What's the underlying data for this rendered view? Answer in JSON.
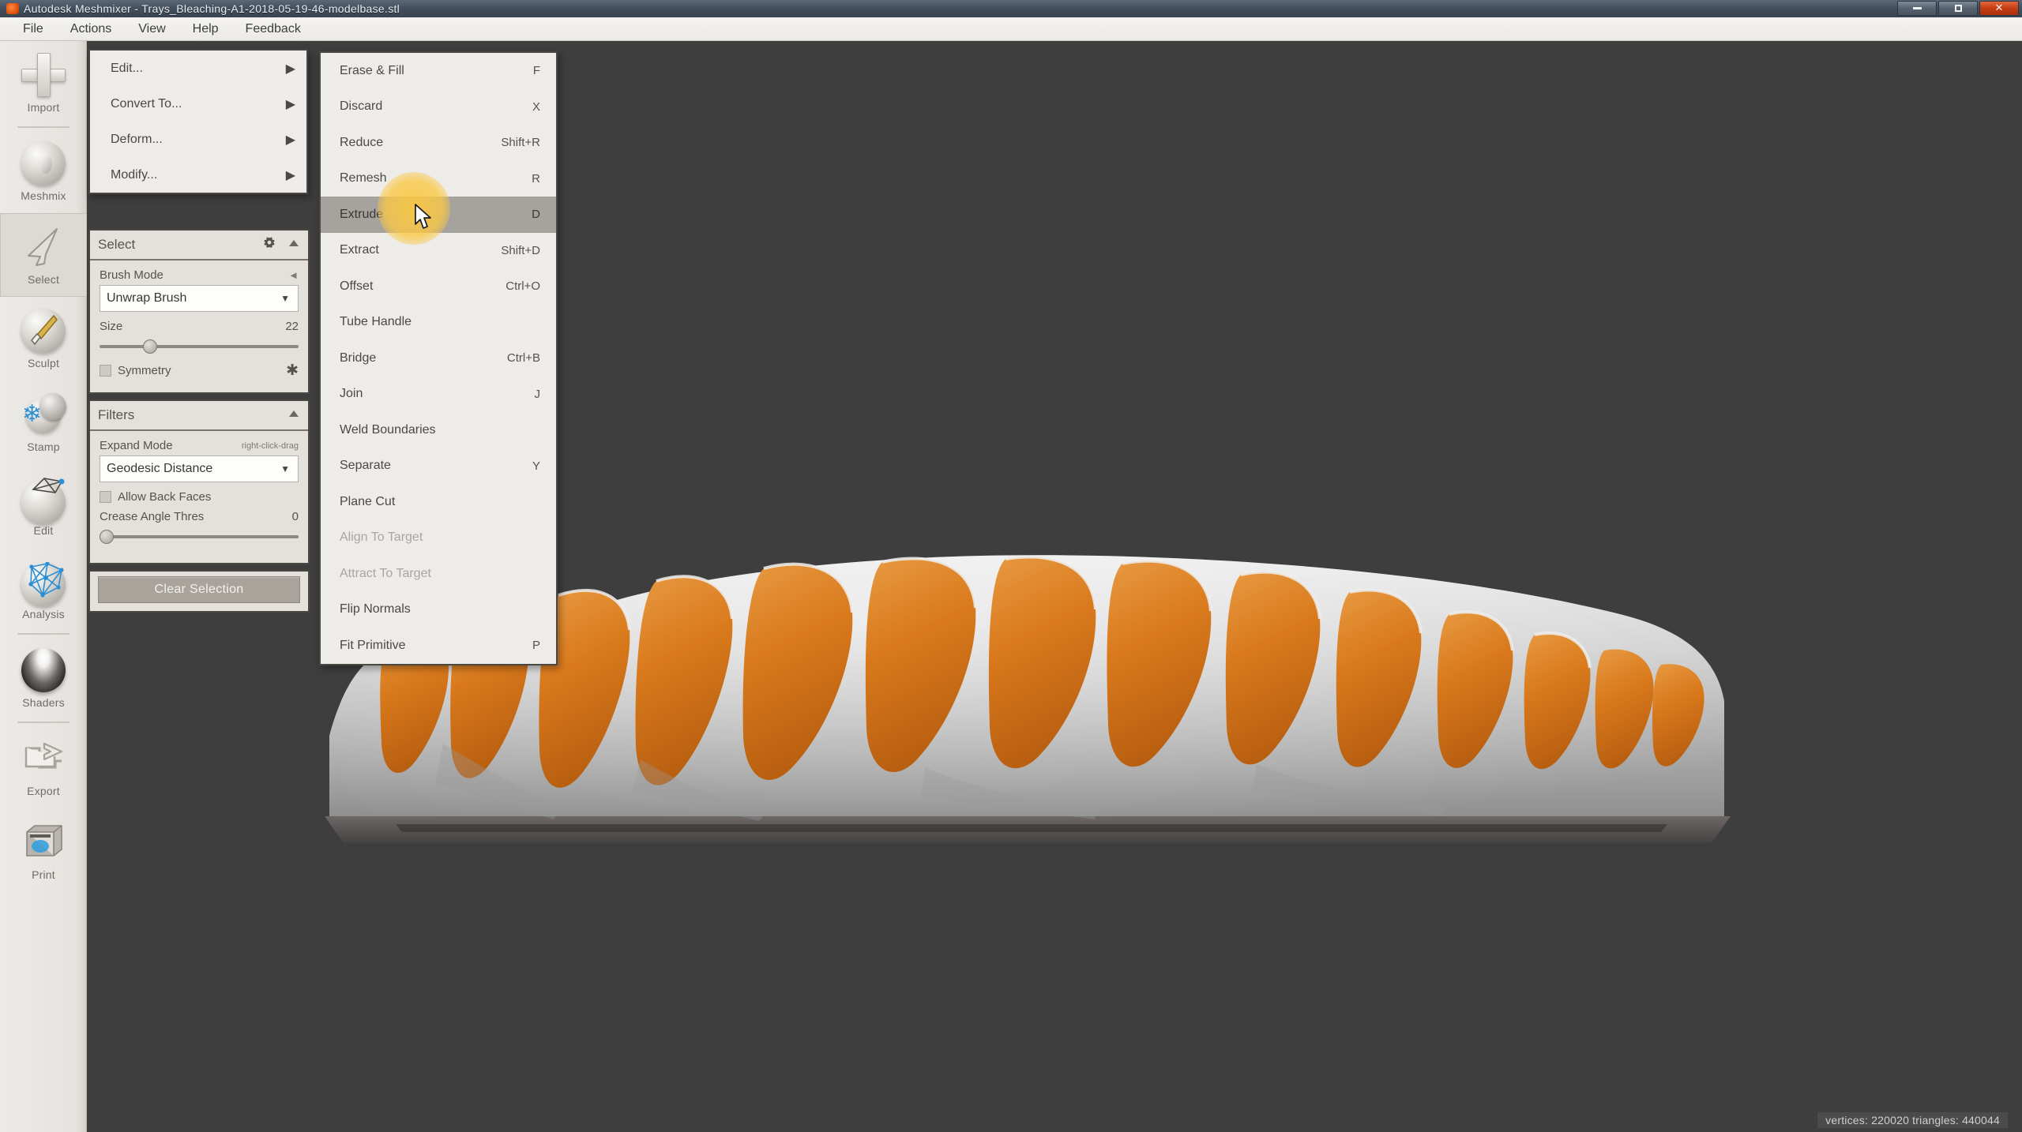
{
  "window": {
    "title": "Autodesk Meshmixer - Trays_Bleaching-A1-2018-05-19-46-modelbase.stl",
    "minimize_label": "Minimize",
    "maximize_label": "Maximize",
    "close_label": "Close"
  },
  "menubar": {
    "items": [
      {
        "label": "File"
      },
      {
        "label": "Actions"
      },
      {
        "label": "View"
      },
      {
        "label": "Help"
      },
      {
        "label": "Feedback"
      }
    ]
  },
  "toolrail": {
    "items": [
      {
        "label": "Import",
        "icon": "plus-icon",
        "active": false
      },
      {
        "label": "Meshmix",
        "icon": "sphere-face-icon",
        "active": false
      },
      {
        "label": "Select",
        "icon": "arrow-cursor-icon",
        "active": true
      },
      {
        "label": "Sculpt",
        "icon": "brush-sphere-icon",
        "active": false
      },
      {
        "label": "Stamp",
        "icon": "stamp-icon",
        "active": false
      },
      {
        "label": "Edit",
        "icon": "edit-wire-icon",
        "active": false
      },
      {
        "label": "Analysis",
        "icon": "analysis-grid-icon",
        "active": false
      },
      {
        "label": "Shaders",
        "icon": "shader-dome-icon",
        "active": false
      },
      {
        "label": "Export",
        "icon": "export-arrow-icon",
        "active": false
      },
      {
        "label": "Print",
        "icon": "printer-icon",
        "active": false
      }
    ]
  },
  "popup_actions": {
    "items": [
      {
        "label": "Edit...",
        "submenu": true
      },
      {
        "label": "Convert To...",
        "submenu": true
      },
      {
        "label": "Deform...",
        "submenu": true
      },
      {
        "label": "Modify...",
        "submenu": true
      }
    ]
  },
  "popup_edit": {
    "items": [
      {
        "label": "Erase & Fill",
        "shortcut": "F",
        "disabled": false,
        "selected": false
      },
      {
        "label": "Discard",
        "shortcut": "X",
        "disabled": false,
        "selected": false
      },
      {
        "label": "Reduce",
        "shortcut": "Shift+R",
        "disabled": false,
        "selected": false
      },
      {
        "label": "Remesh",
        "shortcut": "R",
        "disabled": false,
        "selected": false
      },
      {
        "label": "Extrude",
        "shortcut": "D",
        "disabled": false,
        "selected": true
      },
      {
        "label": "Extract",
        "shortcut": "Shift+D",
        "disabled": false,
        "selected": false
      },
      {
        "label": "Offset",
        "shortcut": "Ctrl+O",
        "disabled": false,
        "selected": false
      },
      {
        "label": "Tube Handle",
        "shortcut": "",
        "disabled": false,
        "selected": false
      },
      {
        "label": "Bridge",
        "shortcut": "Ctrl+B",
        "disabled": false,
        "selected": false
      },
      {
        "label": "Join",
        "shortcut": "J",
        "disabled": false,
        "selected": false
      },
      {
        "label": "Weld Boundaries",
        "shortcut": "",
        "disabled": false,
        "selected": false
      },
      {
        "label": "Separate",
        "shortcut": "Y",
        "disabled": false,
        "selected": false
      },
      {
        "label": "Plane Cut",
        "shortcut": "",
        "disabled": false,
        "selected": false
      },
      {
        "label": "Align To Target",
        "shortcut": "",
        "disabled": true,
        "selected": false
      },
      {
        "label": "Attract To Target",
        "shortcut": "",
        "disabled": true,
        "selected": false
      },
      {
        "label": "Flip Normals",
        "shortcut": "",
        "disabled": false,
        "selected": false
      },
      {
        "label": "Fit Primitive",
        "shortcut": "P",
        "disabled": false,
        "selected": false
      }
    ]
  },
  "select_panel": {
    "title": "Select",
    "gear_icon": "gear-icon",
    "collapse_icon": "chevron-up-icon",
    "brush_mode_label": "Brush Mode",
    "brush_mode_value": "Unwrap Brush",
    "size_label": "Size",
    "size_value": "22",
    "size_percent": 22,
    "symmetry_label": "Symmetry",
    "symmetry_checked": false,
    "symmetry_icon": "asterisk-icon"
  },
  "filters_panel": {
    "title": "Filters",
    "collapse_icon": "chevron-up-icon",
    "expand_mode_label": "Expand Mode",
    "expand_mode_hint": "right-click-drag",
    "expand_mode_value": "Geodesic Distance",
    "allow_back_faces_label": "Allow Back Faces",
    "allow_back_faces_checked": false,
    "crease_label": "Crease Angle Thres",
    "crease_value": "0",
    "crease_percent": 0
  },
  "actions_panel": {
    "clear_selection_label": "Clear Selection"
  },
  "viewport": {
    "status": "vertices: 220020 triangles: 440044",
    "background_color": "#3e3e3e",
    "selection_color": "#d97b1e",
    "mesh_color": "#c9c9c9"
  },
  "cursor": {
    "icon": "mouse-pointer-icon",
    "click_highlight_color": "#f5c84a"
  }
}
